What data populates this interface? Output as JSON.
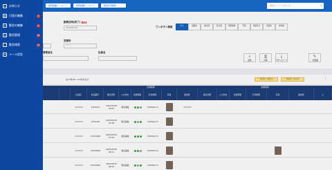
{
  "header": {
    "breadcrumbs": [
      "検索画面0 - ヘルプ",
      "検索画面0 - ヘルプ",
      "勤怠状況確認"
    ],
    "search_placeholder": "検索キーワードを入力"
  },
  "sidebar": {
    "items": [
      {
        "label": "お知らせ",
        "icon": "home-icon",
        "badge": ""
      },
      {
        "label": "日程の編集",
        "icon": "calendar-icon",
        "badge": "2"
      },
      {
        "label": "勤怠の編集",
        "icon": "edit-icon",
        "badge": "4"
      },
      {
        "label": "勤怠管理",
        "icon": "clock-icon",
        "badge": "10"
      },
      {
        "label": "勤怠検索",
        "icon": "search-icon",
        "badge": "11"
      },
      {
        "label": "メール設定",
        "icon": "mail-icon",
        "badge": ""
      }
    ]
  },
  "form": {
    "date_label": "勤務日時(終了)",
    "required": "必須",
    "date_value": "2023/05/30",
    "dept_label": "営業所",
    "dept_value": "ーー",
    "manager_label": "管理者名",
    "staff_label": "社員名",
    "one_touch_label": "ワンボタン検索",
    "segments": [
      "全て",
      "退勤前",
      "未打刻",
      "乱打刻",
      "位置情報",
      "写真",
      "承認待ち",
      "承認済",
      "未承認"
    ],
    "actions": [
      {
        "label": "検索",
        "icon": "search-icon"
      },
      {
        "label": "印刷",
        "icon": "print-icon"
      },
      {
        "label": "ダウンロード",
        "icon": "download-icon"
      },
      {
        "label": "一括編集",
        "icon": "edit-icon"
      }
    ]
  },
  "list": {
    "count_text": "全16件中1〜16件を表示",
    "bulk_update_labels": [
      "一括承認（選択分）",
      "一括承認（表示分）"
    ],
    "group_headers": [
      "出勤情報",
      "退勤情報"
    ],
    "columns": [
      "社員名",
      "社員番号",
      "勤怠日時",
      "入力方法",
      "位置情報",
      "打刻状態",
      "写真",
      "確認者",
      "勤怠日時",
      "入力方法",
      "位置情報",
      "打刻状態",
      "写真",
      "確認者"
    ],
    "rows": [
      {
        "id": "21b4C21",
        "datetime": "2023/05/30 08:52",
        "method": "勤怠編集",
        "memo": "0.000km(1)"
      },
      {
        "id": "215C220",
        "datetime": "2023/05/30 07:48",
        "method": "勤怠編集",
        "memo": "0.000km(1)"
      },
      {
        "id": "215C9928",
        "datetime": "2023/05/30 07:55",
        "method": "勤怠編集",
        "memo": "0.000km(1)"
      },
      {
        "id": "215C9005",
        "datetime": "2023/05/30 08:11",
        "method": "勤怠編集",
        "memo": "0.000km(1)"
      },
      {
        "id": "215C9020",
        "datetime": "2023/05/30 08:20",
        "method": "勤怠編集",
        "memo": "0.000km(1)"
      }
    ]
  }
}
